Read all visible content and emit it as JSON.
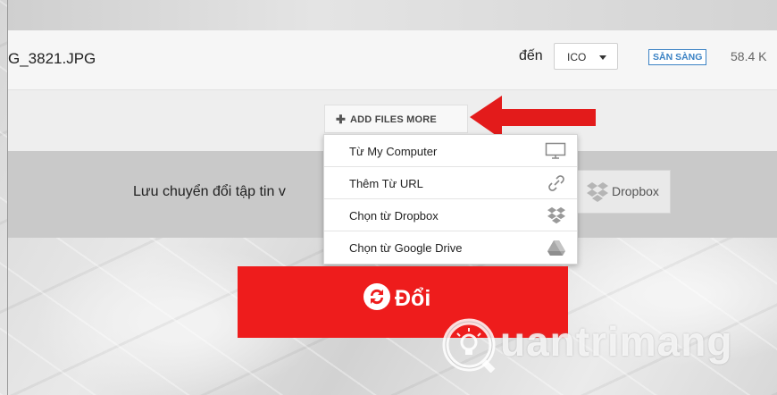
{
  "file": {
    "name": "G_3821.JPG",
    "to_label": "đến",
    "format": "ICO",
    "status": "SẴN SÀNG",
    "size": "58.4 K"
  },
  "add_files": {
    "label": "ADD FILES MORE"
  },
  "menu": {
    "items": [
      {
        "label": "Từ My Computer",
        "icon": "monitor-icon"
      },
      {
        "label": "Thêm Từ URL",
        "icon": "link-icon"
      },
      {
        "label": "Chọn từ Dropbox",
        "icon": "dropbox-icon"
      },
      {
        "label": "Chọn từ Google Drive",
        "icon": "google-drive-icon"
      }
    ]
  },
  "save_bar": {
    "text": "Lưu chuyển đổi tập tin v",
    "dropbox_label": "Dropbox"
  },
  "convert_button": {
    "label": "Đổi"
  },
  "watermark": {
    "text": "uantrimang"
  },
  "colors": {
    "convert_red": "#ee1c1c",
    "badge_blue": "#3b82c4",
    "arrow_red": "#e31b1b"
  }
}
